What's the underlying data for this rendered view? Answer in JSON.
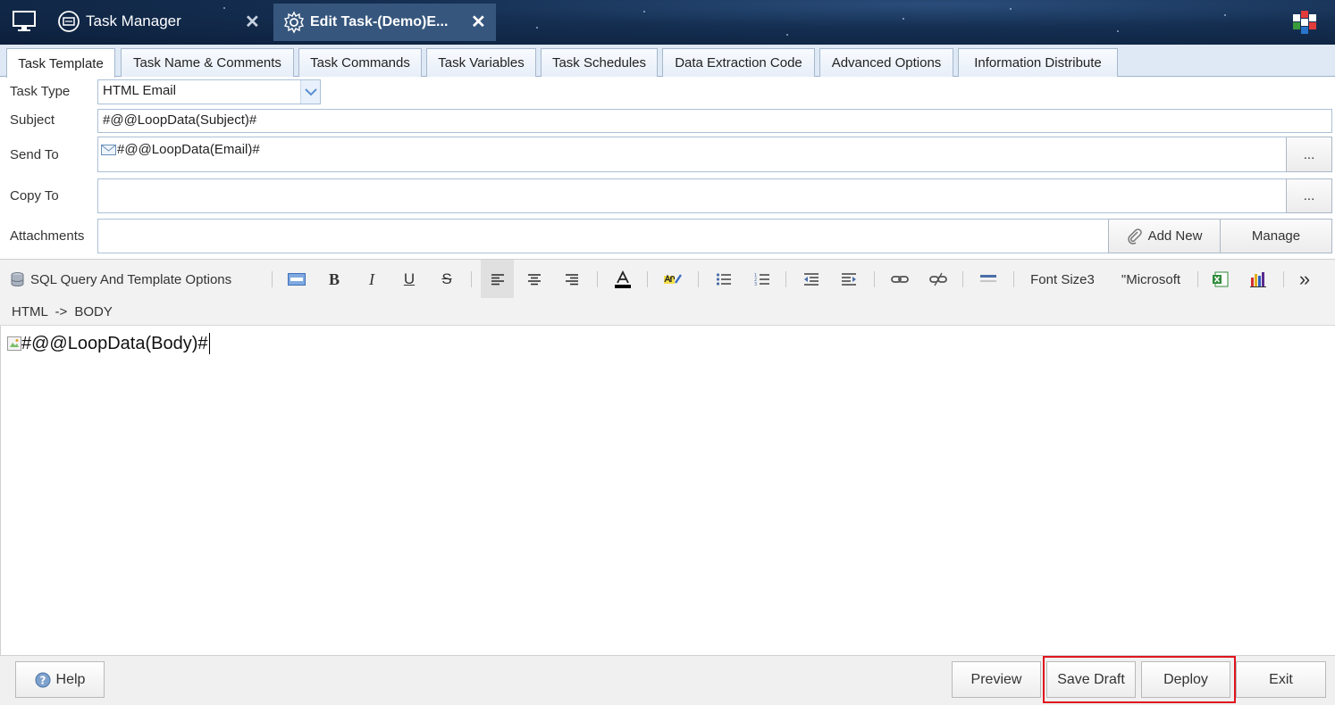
{
  "titlebar": {
    "tabs": [
      {
        "label": "Task Manager"
      },
      {
        "label": "Edit Task-(Demo)E..."
      }
    ]
  },
  "tabs": [
    {
      "label": "Task Template"
    },
    {
      "label": "Task Name & Comments"
    },
    {
      "label": "Task Commands"
    },
    {
      "label": "Task Variables"
    },
    {
      "label": "Task Schedules"
    },
    {
      "label": "Data Extraction Code"
    },
    {
      "label": "Advanced Options"
    },
    {
      "label": "Information Distribute"
    }
  ],
  "form": {
    "task_type_label": "Task Type",
    "task_type_value": "HTML Email",
    "subject_label": "Subject",
    "subject_value": "#@@LoopData(Subject)#",
    "send_to_label": "Send To",
    "send_to_value": "#@@LoopData(Email)#",
    "copy_to_label": "Copy To",
    "copy_to_value": "",
    "attachments_label": "Attachments",
    "ellipsis": "...",
    "add_new_label": "Add New",
    "manage_label": "Manage"
  },
  "toolbar": {
    "sql_label": "SQL Query And Template Options",
    "bold": "B",
    "italic": "I",
    "underline": "U",
    "strike": "S",
    "font_size": "Font Size3",
    "font_name": "\"Microsoft",
    "more": "»"
  },
  "pathbar": {
    "path": "HTML -> BODY"
  },
  "editor": {
    "content": "#@@LoopData(Body)#"
  },
  "footer": {
    "help": "Help",
    "preview": "Preview",
    "save_draft": "Save Draft",
    "deploy": "Deploy",
    "exit": "Exit"
  },
  "colors": {
    "highlight": "#e0141e",
    "titlebar": "#152f52",
    "active_window_tab": "#36567d"
  }
}
